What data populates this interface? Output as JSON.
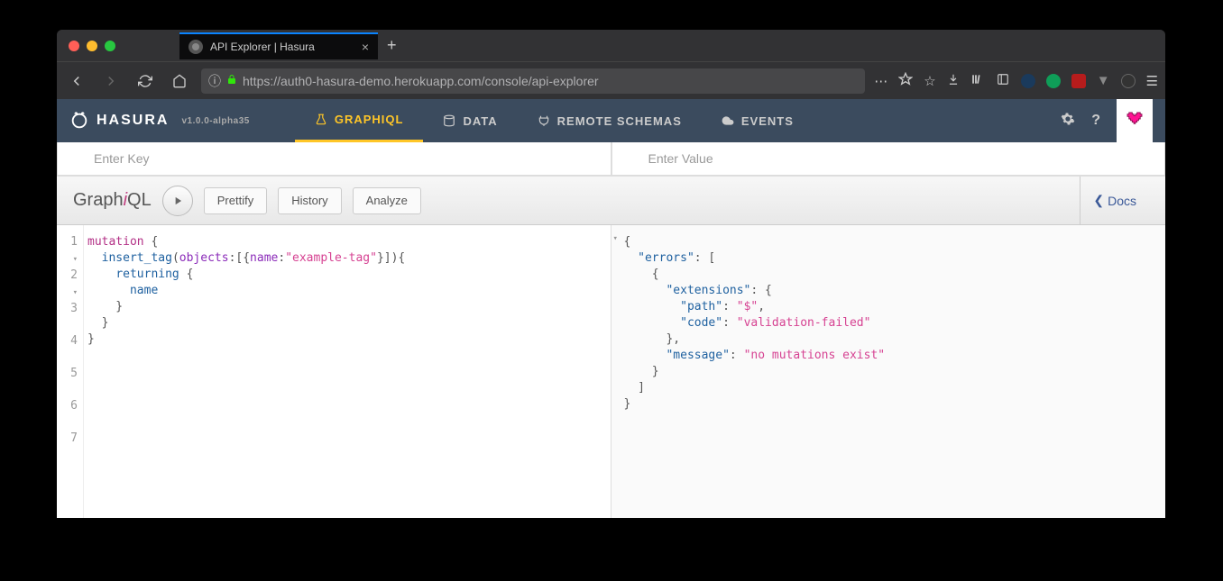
{
  "browser": {
    "tab_title": "API Explorer | Hasura",
    "url_display": "https://auth0-hasura-demo.herokuapp.com/console/api-explorer"
  },
  "hasura": {
    "brand": "HASURA",
    "version": "v1.0.0-alpha35",
    "tabs": {
      "graphiql": "GRAPHIQL",
      "data": "DATA",
      "remote_schemas": "REMOTE SCHEMAS",
      "events": "EVENTS"
    }
  },
  "headers": {
    "key_placeholder": "Enter Key",
    "value_placeholder": "Enter Value"
  },
  "graphiql": {
    "brand_prefix": "Graph",
    "brand_italic": "i",
    "brand_suffix": "QL",
    "prettify": "Prettify",
    "history": "History",
    "analyze": "Analyze",
    "docs": "Docs"
  },
  "query": {
    "line1_kw": "mutation",
    "line1_rest": " {",
    "line2_fn": "insert_tag",
    "line2_p1": "(",
    "line2_attr1": "objects",
    "line2_p2": ":[{",
    "line2_attr2": "name",
    "line2_p3": ":",
    "line2_str": "\"example-tag\"",
    "line2_p4": "}]){",
    "line3_fn": "returning",
    "line3_rest": " {",
    "line4": "name",
    "line5": "    }",
    "line6": "  }",
    "line7": "}",
    "gutter": [
      "1",
      "2",
      "3",
      "4",
      "5",
      "6",
      "7"
    ]
  },
  "result": {
    "l1": "{",
    "l2_key": "\"errors\"",
    "l2_rest": ": [",
    "l3": "    {",
    "l4_key": "\"extensions\"",
    "l4_rest": ": {",
    "l5_key": "\"path\"",
    "l5_val": "\"$\"",
    "l6_key": "\"code\"",
    "l6_val": "\"validation-failed\"",
    "l7": "      },",
    "l8_key": "\"message\"",
    "l8_val": "\"no mutations exist\"",
    "l9": "    }",
    "l10": "  ]",
    "l11": "}"
  }
}
